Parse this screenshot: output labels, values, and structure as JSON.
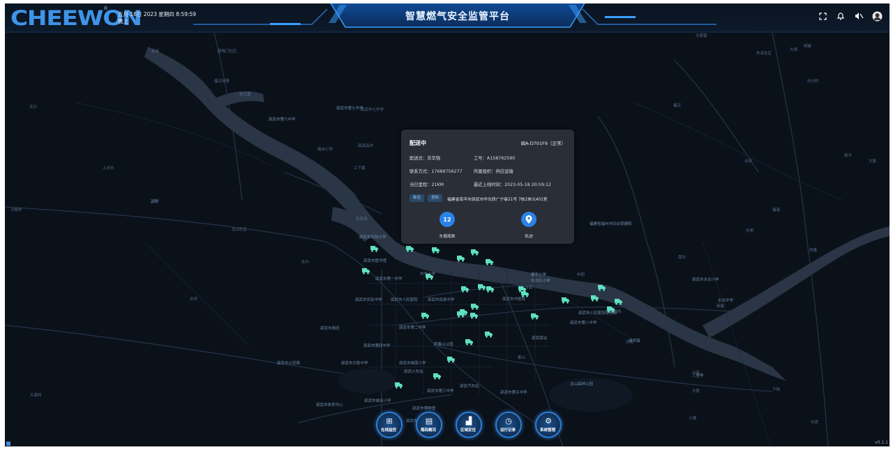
{
  "header": {
    "logo": "CHEEWON",
    "logo_mark": "®",
    "date_line": "五月 18日 2023 星期四 8:59:59",
    "period": "晚上",
    "title": "智慧燃气安全监管平台",
    "icons": [
      "fullscreen-icon",
      "bell-icon",
      "mute-icon",
      "user-avatar-icon"
    ]
  },
  "map_labels": [
    "大英镇",
    "明晏",
    "北沙",
    "有谷",
    "鹤鸣门社区",
    "桂王墓",
    "霞台小学",
    "邵武高中",
    "上井头",
    "江下窠",
    "正阳",
    "北山社区",
    "福汉谷隆",
    "东升",
    "东方红",
    "中和",
    "邵武市七中学",
    "有安旭",
    "东关社区",
    "沙帐村",
    "大堡",
    "大演村",
    "福汉",
    "和平",
    "新桥",
    "东明",
    "西隆",
    "福溪",
    "南坊",
    "长坪",
    "上塘",
    "下阳",
    "长官",
    "白沙村",
    "大埠",
    "大乾",
    "都山",
    "合坑",
    "新屋",
    "乐天",
    "兴旺"
  ],
  "places": [
    "邵武市实验小学",
    "中华小学",
    "福建省福州市妇幼保健院",
    "春华小学",
    "邵武市第一中学",
    "邵武市民族中学",
    "邵武市人民医院",
    "东方红小学",
    "邵武市实验中学",
    "邵武市第二中学",
    "邵武市第四中学",
    "邵武市中医院",
    "邵武市体育中心",
    "邵武市城关小学",
    "邵武市水北小学",
    "水北中学",
    "邵武市城南小学",
    "邵武市大乾中学",
    "邵武市图书馆",
    "邵武市博物馆",
    "邵武市政府",
    "邵武市公安局",
    "邵武市第三中学",
    "三里亭",
    "四周码头",
    "龙山森林公园",
    "熙春山公园",
    "城郊镇",
    "邵武南站",
    "邵武火车站",
    "邵武汽车站",
    "邵武市人民医院住院部",
    "邵武市第五中学",
    "邵武市第六中学",
    "邵武市第七中学",
    "邵武市第八中学",
    "邵武市职业中专"
  ],
  "popup": {
    "status": "配送中",
    "plate": "闽A-D701F9（正常）",
    "driver_label": "配送员：",
    "driver": "苏华强",
    "job_label": "工号：",
    "job_no": "A158762590",
    "phone_label": "联系方式：",
    "phone": "17689756277",
    "org_label": "所属组织：",
    "org": "供应运输",
    "mileage_label": "当日里程：",
    "mileage": "21KM",
    "last_online_label": "最近上线时间：",
    "last_online": "2023-05-18 20:59:12",
    "tag_mark": "标注",
    "tag_coord": "坐标",
    "address": "福建省南平市邵武市华光西广宁巷21号 7栋2单元401室",
    "cylinders_count": "12",
    "cylinders_label": "车载瓶数",
    "track_label": "轨迹"
  },
  "bottom_nav": [
    {
      "label": "在线监控",
      "icon": "grid-icon",
      "glyph": "⊞"
    },
    {
      "label": "瓶码概况",
      "icon": "chart-icon",
      "glyph": "▤"
    },
    {
      "label": "区域定位",
      "icon": "building-icon",
      "glyph": "▟"
    },
    {
      "label": "运行记录",
      "icon": "clock-icon",
      "glyph": "◷"
    },
    {
      "label": "系统管理",
      "icon": "gear-icon",
      "glyph": "⚙"
    }
  ],
  "version": "v0.1.1",
  "colors": {
    "accent": "#2a82e6",
    "truck": "#5fe0c0",
    "map_bg": "#0b1119",
    "water": "#2a3646"
  }
}
